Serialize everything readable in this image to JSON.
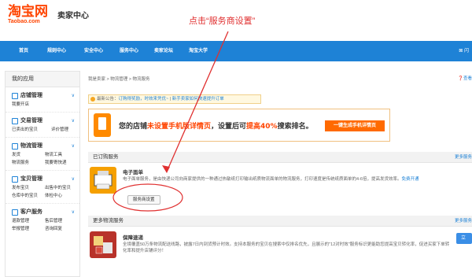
{
  "header": {
    "logo_cn": "淘宝网",
    "logo_en": "Taobao.com",
    "title": "卖家中心",
    "annotation": "点击“服务商设置”"
  },
  "nav": {
    "items": [
      "首页",
      "规则中心",
      "安全中心",
      "服务中心",
      "卖家论坛",
      "淘宝大学"
    ],
    "right": "闪"
  },
  "sidebar": {
    "title": "我的应用",
    "groups": [
      {
        "title": "店铺管理",
        "links": [
          "我要开店"
        ]
      },
      {
        "title": "交易管理",
        "links": [
          "已卖出的宝贝",
          "评价管理"
        ]
      },
      {
        "title": "物流管理",
        "links": [
          "发货",
          "物流工具",
          "物流服务",
          "我要寄快递"
        ]
      },
      {
        "title": "宝贝管理",
        "links": [
          "发布宝贝",
          "出售中的宝贝",
          "仓库中的宝贝",
          "体检中心"
        ]
      },
      {
        "title": "客户服务",
        "links": [
          "退款管理",
          "售后管理",
          "举报管理",
          "咨询回复"
        ]
      }
    ]
  },
  "main": {
    "breadcrumb": "我是卖家 > 物流管理 > 物流服务",
    "help": "查看",
    "notice_prefix": "最新公告：",
    "notice_link1": "订购得奖励，时效来凭优~",
    "notice_sep": " | ",
    "notice_link2": "新手卖家如何快速提升订单",
    "banner": {
      "text_prefix": "您的店铺",
      "text_highlight1": "未设置手机版详情页",
      "text_middle": "，设置后可",
      "text_highlight2": "提高40%",
      "text_suffix": "搜索排名。",
      "button": "一键生成手机详情页"
    },
    "ordered": {
      "title": "已订购服务",
      "more": "更多服务",
      "name": "电子面单",
      "desc_prefix": "电子面单服务，是由快递公司向商家提供的一种通过热敏纸打印输出纸质物流面单的物流服务，打印速度是传统纸质面单的4-6倍，提高发货效率。",
      "desc_link": "免费开通",
      "button": "服务商设置"
    },
    "more_services": {
      "title": "更多物流服务",
      "more": "更多服务",
      "name": "保障速递",
      "desc": "全境覆盖50万条物流配送线路，披露7日内到货预计时效。支持本服务的宝贝在搜索中仅排名优先，且展示的\"12对时效\"服务标识更能助您提高宝贝转化率，促进买家下单转化率和提升店铺评分！",
      "button": "立即"
    }
  },
  "colors": {
    "brand": "#ff4400",
    "nav": "#1e82d6",
    "annotation": "#e03030"
  }
}
